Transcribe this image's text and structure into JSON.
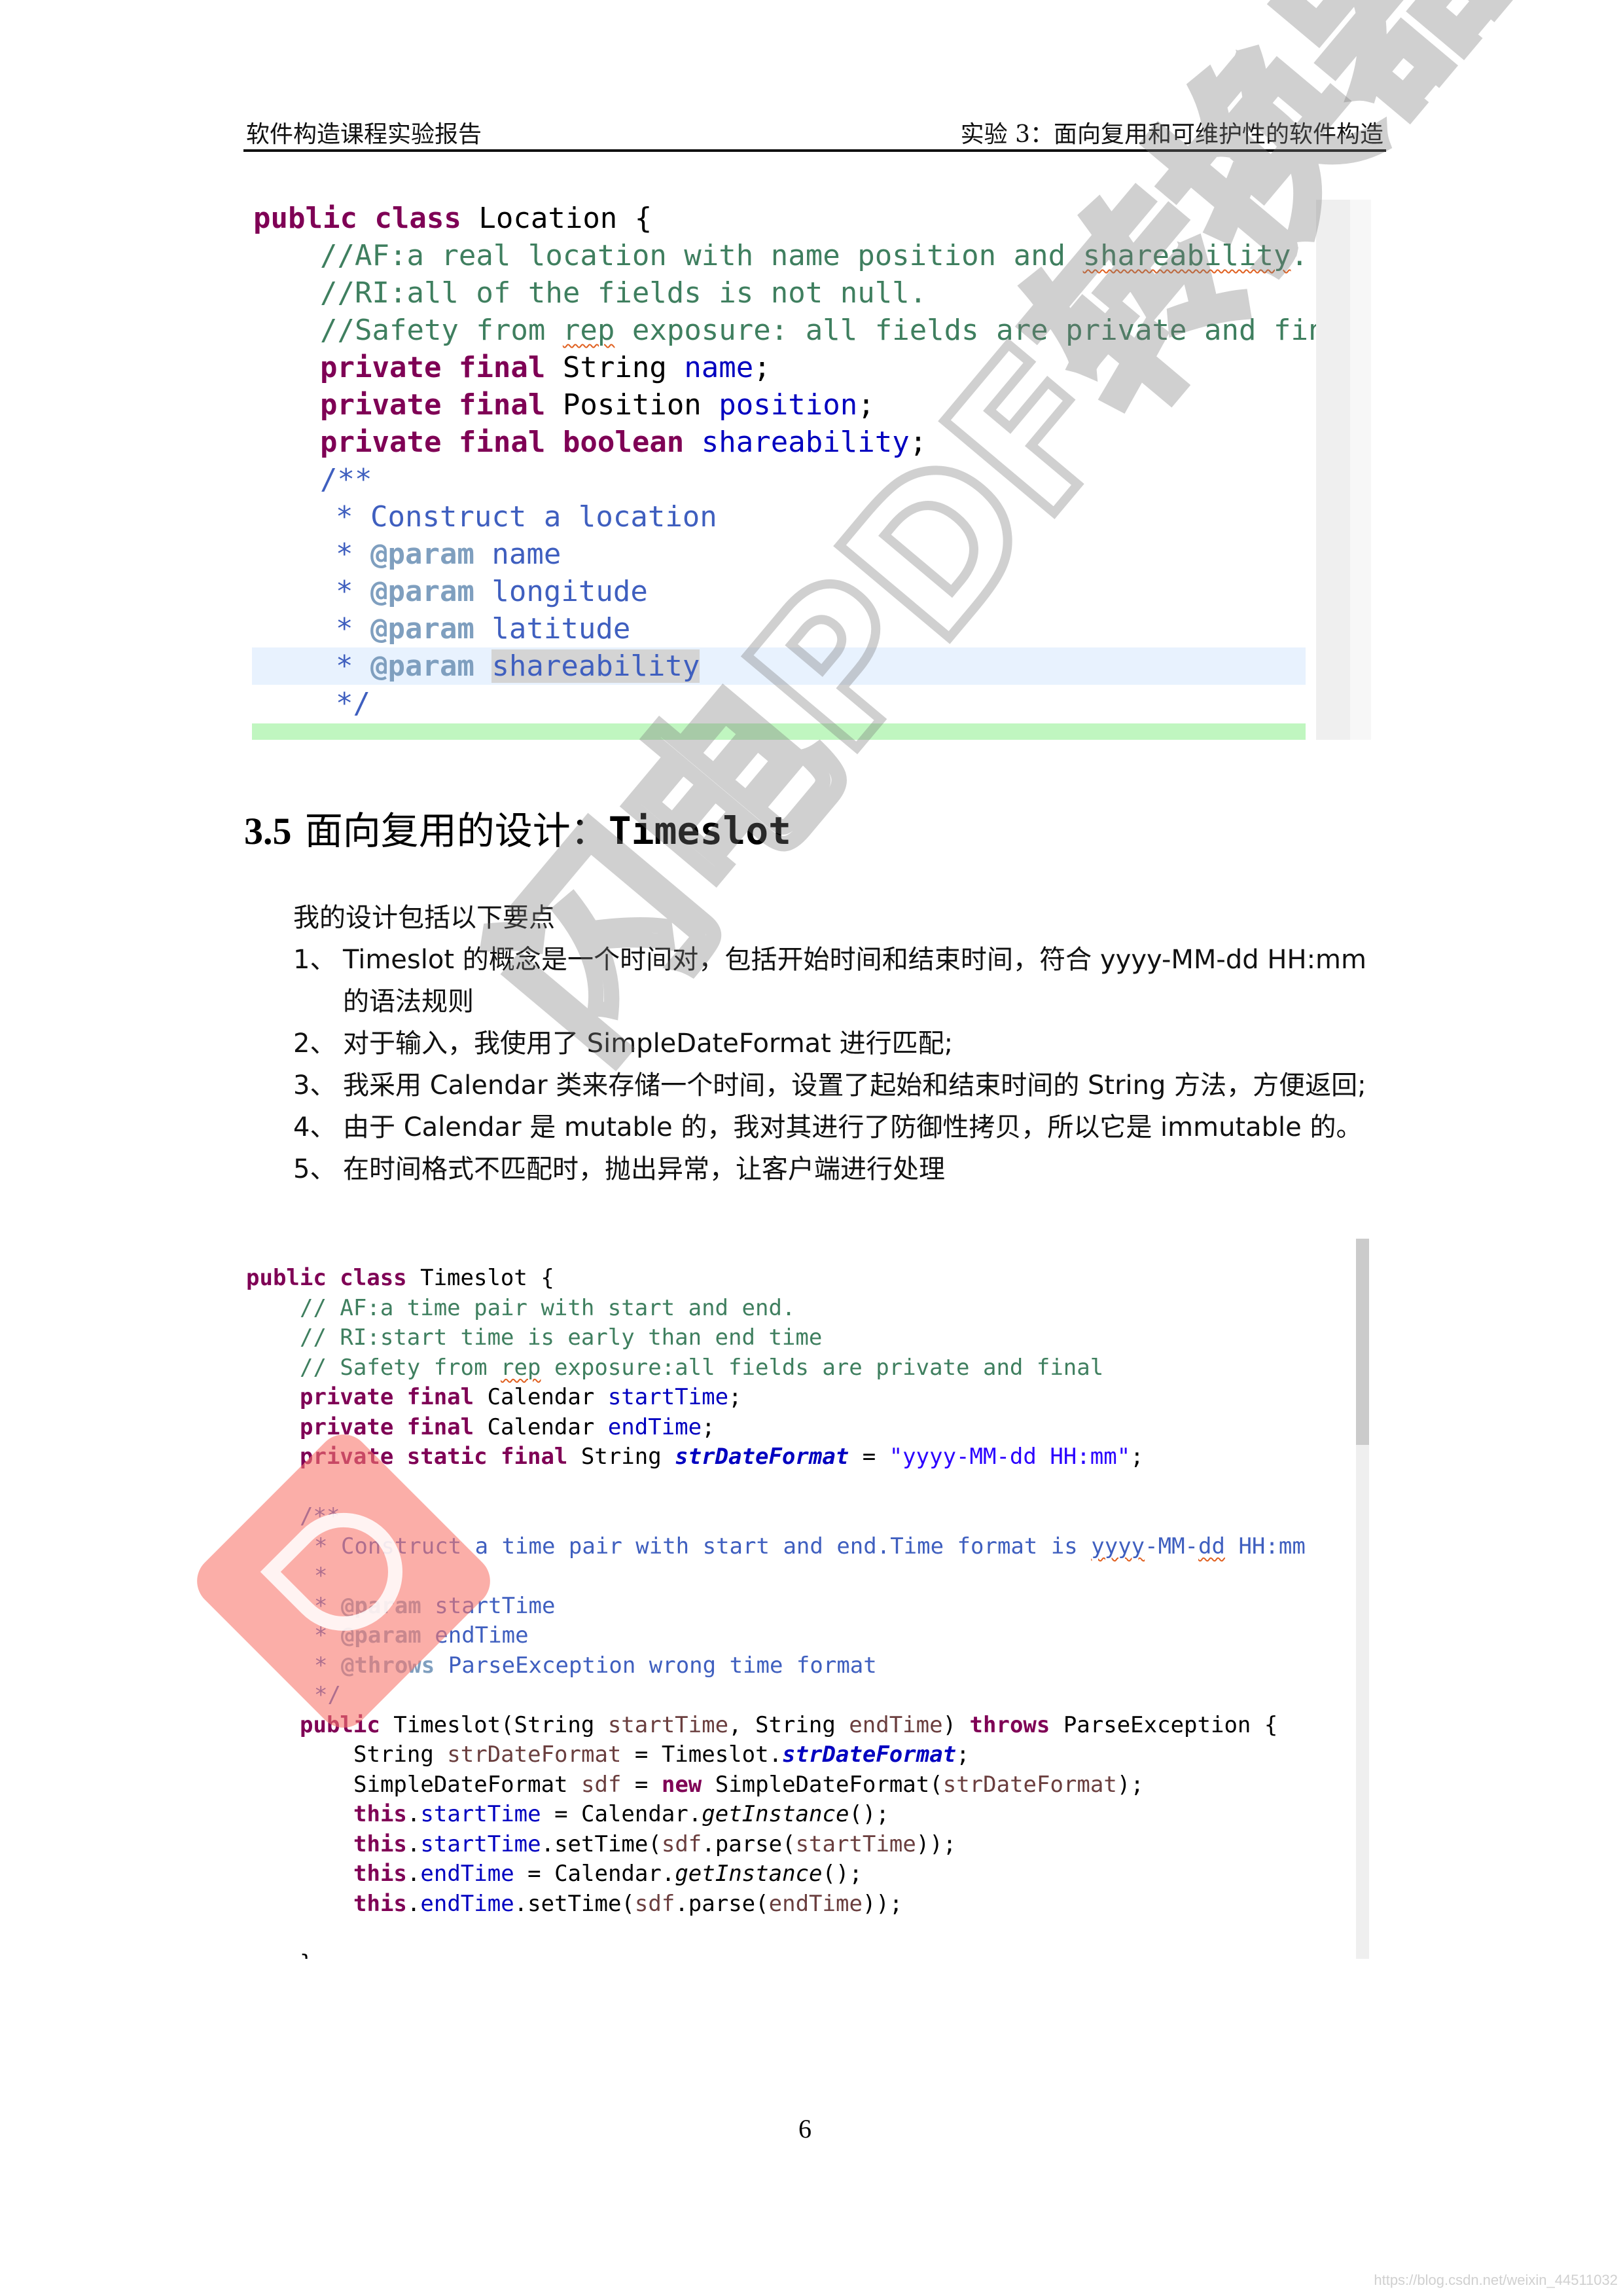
{
  "header": {
    "left": "软件构造课程实验报告",
    "right": "实验 3：面向复用和可维护性的软件构造"
  },
  "code_block_1": {
    "lines": [
      {
        "parts": [
          [
            "kw",
            "public class "
          ],
          [
            "",
            "Location {"
          ]
        ]
      },
      {
        "parts": [
          [
            "cm",
            "//AF:a real location with name position and "
          ],
          [
            "cm squig",
            "shareability"
          ],
          [
            "cm",
            "."
          ]
        ],
        "indent": 1
      },
      {
        "parts": [
          [
            "cm",
            "//RI:all of the fields is not null."
          ]
        ],
        "indent": 1
      },
      {
        "parts": [
          [
            "cm",
            "//Safety from "
          ],
          [
            "cm squig",
            "rep"
          ],
          [
            "cm",
            " exposure: all fields are private and fina"
          ]
        ],
        "indent": 1
      },
      {
        "parts": [
          [
            "kw",
            "private final "
          ],
          [
            "",
            "String "
          ],
          [
            "fld",
            "name"
          ],
          [
            "",
            ";"
          ]
        ],
        "indent": 1
      },
      {
        "parts": [
          [
            "kw",
            "private final "
          ],
          [
            "",
            "Position "
          ],
          [
            "fld",
            "position"
          ],
          [
            "",
            ";"
          ]
        ],
        "indent": 1
      },
      {
        "parts": [
          [
            "kw",
            "private final boolean "
          ],
          [
            "fld",
            "shareability"
          ],
          [
            "",
            ";"
          ]
        ],
        "indent": 1
      },
      {
        "parts": [
          [
            "jd",
            "/**"
          ]
        ],
        "indent": 1
      },
      {
        "parts": [
          [
            "jd",
            "* Construct a location"
          ]
        ],
        "indent": 2
      },
      {
        "parts": [
          [
            "jd",
            "* "
          ],
          [
            "tag",
            "@param"
          ],
          [
            "jd",
            " name"
          ]
        ],
        "indent": 2
      },
      {
        "parts": [
          [
            "jd",
            "* "
          ],
          [
            "tag",
            "@param"
          ],
          [
            "jd",
            " longitude"
          ]
        ],
        "indent": 2
      },
      {
        "parts": [
          [
            "jd",
            "* "
          ],
          [
            "tag",
            "@param"
          ],
          [
            "jd",
            " latitude"
          ]
        ],
        "indent": 2
      },
      {
        "parts": [
          [
            "jd",
            "* "
          ],
          [
            "tag",
            "@param"
          ],
          [
            "jd",
            " "
          ],
          [
            "jd sel",
            "shareability"
          ]
        ],
        "indent": 2,
        "highlight": true
      },
      {
        "parts": [
          [
            "jd",
            "*/"
          ]
        ],
        "indent": 2
      }
    ]
  },
  "section": {
    "number": "3.5",
    "title_zh": "面向复用的设计：",
    "title_code": "Timeslot"
  },
  "body": {
    "intro": "我的设计包括以下要点",
    "items": [
      {
        "n": "1、",
        "text": "Timeslot 的概念是一个时间对，包括开始时间和结束时间，符合 yyyy-MM-dd HH:mm 的语法规则"
      },
      {
        "n": "2、",
        "text": "对于输入，我使用了 SimpleDateFormat 进行匹配;"
      },
      {
        "n": "3、",
        "text": "我采用 Calendar 类来存储一个时间，设置了起始和结束时间的 String 方法，方便返回;"
      },
      {
        "n": "4、",
        "text": "由于 Calendar 是 mutable 的，我对其进行了防御性拷贝，所以它是 immutable 的。"
      },
      {
        "n": "5、",
        "text": "在时间格式不匹配时，抛出异常，让客户端进行处理"
      }
    ]
  },
  "code_block_2": {
    "lines": [
      {
        "parts": [
          [
            "kw",
            "public class "
          ],
          [
            "",
            "Timeslot {"
          ]
        ]
      },
      {
        "parts": [
          [
            "cm",
            "// AF:a time pair with start and end."
          ]
        ],
        "indent": "i1"
      },
      {
        "parts": [
          [
            "cm",
            "// RI:start time is early than end time"
          ]
        ],
        "indent": "i1"
      },
      {
        "parts": [
          [
            "cm",
            "// Safety from "
          ],
          [
            "cm squig",
            "rep"
          ],
          [
            "cm",
            " exposure:all fields are private and final"
          ]
        ],
        "indent": "i1"
      },
      {
        "parts": [
          [
            "kw",
            "private final "
          ],
          [
            "",
            "Calendar "
          ],
          [
            "fld",
            "startTime"
          ],
          [
            "",
            ";"
          ]
        ],
        "indent": "i1"
      },
      {
        "parts": [
          [
            "kw",
            "private final "
          ],
          [
            "",
            "Calendar "
          ],
          [
            "fld",
            "endTime"
          ],
          [
            "",
            ";"
          ]
        ],
        "indent": "i1"
      },
      {
        "parts": [
          [
            "kw",
            "private static final "
          ],
          [
            "",
            "String "
          ],
          [
            "sfld",
            "strDateFormat"
          ],
          [
            "",
            " = "
          ],
          [
            "str",
            "\"yyyy-MM-dd HH:mm\""
          ],
          [
            "",
            ";"
          ]
        ],
        "indent": "i1"
      },
      {
        "blank": true
      },
      {
        "parts": [
          [
            "jd",
            "/**"
          ]
        ],
        "indent": "i1"
      },
      {
        "parts": [
          [
            "jd",
            "* Construct a time pair with start and end.Time format is "
          ],
          [
            "jd squig",
            "yyyy"
          ],
          [
            "jd",
            "-MM-"
          ],
          [
            "jd squig",
            "dd"
          ],
          [
            "jd",
            " HH:mm"
          ]
        ],
        "indent": "i1s"
      },
      {
        "parts": [
          [
            "jd",
            "*"
          ]
        ],
        "indent": "i1s"
      },
      {
        "parts": [
          [
            "jd",
            "* "
          ],
          [
            "tag",
            "@param"
          ],
          [
            "jd",
            " startTime"
          ]
        ],
        "indent": "i1s"
      },
      {
        "parts": [
          [
            "jd",
            "* "
          ],
          [
            "tag",
            "@param"
          ],
          [
            "jd",
            " endTime"
          ]
        ],
        "indent": "i1s"
      },
      {
        "parts": [
          [
            "jd",
            "* "
          ],
          [
            "tag",
            "@throws"
          ],
          [
            "jd",
            " ParseException wrong time format"
          ]
        ],
        "indent": "i1s"
      },
      {
        "parts": [
          [
            "jd",
            "*/"
          ]
        ],
        "indent": "i1s"
      },
      {
        "parts": [
          [
            "kw",
            "public "
          ],
          [
            "",
            "Timeslot(String "
          ],
          [
            "param",
            "startTime"
          ],
          [
            "",
            ", String "
          ],
          [
            "param",
            "endTime"
          ],
          [
            "",
            ") "
          ],
          [
            "kw",
            "throws "
          ],
          [
            "",
            "ParseException {"
          ]
        ],
        "indent": "i1"
      },
      {
        "parts": [
          [
            "",
            "String "
          ],
          [
            "param",
            "strDateFormat"
          ],
          [
            "",
            " = Timeslot."
          ],
          [
            "sfld",
            "strDateFormat"
          ],
          [
            "",
            ";"
          ]
        ],
        "indent": "i2"
      },
      {
        "parts": [
          [
            "",
            "SimpleDateFormat "
          ],
          [
            "param",
            "sdf"
          ],
          [
            "",
            " = "
          ],
          [
            "kw",
            "new "
          ],
          [
            "",
            "SimpleDateFormat("
          ],
          [
            "param",
            "strDateFormat"
          ],
          [
            "",
            ");"
          ]
        ],
        "indent": "i2"
      },
      {
        "parts": [
          [
            "kw",
            "this"
          ],
          [
            "",
            "."
          ],
          [
            "fld",
            "startTime"
          ],
          [
            "",
            " = Calendar."
          ],
          [
            "ital",
            "getInstance"
          ],
          [
            "",
            "();"
          ]
        ],
        "indent": "i2"
      },
      {
        "parts": [
          [
            "kw",
            "this"
          ],
          [
            "",
            "."
          ],
          [
            "fld",
            "startTime"
          ],
          [
            "",
            ".setTime("
          ],
          [
            "param",
            "sdf"
          ],
          [
            "",
            ".parse("
          ],
          [
            "param",
            "startTime"
          ],
          [
            "",
            "));"
          ]
        ],
        "indent": "i2"
      },
      {
        "parts": [
          [
            "kw",
            "this"
          ],
          [
            "",
            "."
          ],
          [
            "fld",
            "endTime"
          ],
          [
            "",
            " = Calendar."
          ],
          [
            "ital",
            "getInstance"
          ],
          [
            "",
            "();"
          ]
        ],
        "indent": "i2"
      },
      {
        "parts": [
          [
            "kw",
            "this"
          ],
          [
            "",
            "."
          ],
          [
            "fld",
            "endTime"
          ],
          [
            "",
            ".setTime("
          ],
          [
            "param",
            "sdf"
          ],
          [
            "",
            ".parse("
          ],
          [
            "param",
            "endTime"
          ],
          [
            "",
            "));"
          ]
        ],
        "indent": "i2"
      },
      {
        "blank": true
      },
      {
        "parts": [
          [
            "",
            "}"
          ]
        ],
        "indent": "i1"
      }
    ]
  },
  "footer": {
    "page_number": "6",
    "source_url": "https://blog.csdn.net/weixin_44511032"
  },
  "watermark": {
    "text": "闪电PDF转换器"
  }
}
